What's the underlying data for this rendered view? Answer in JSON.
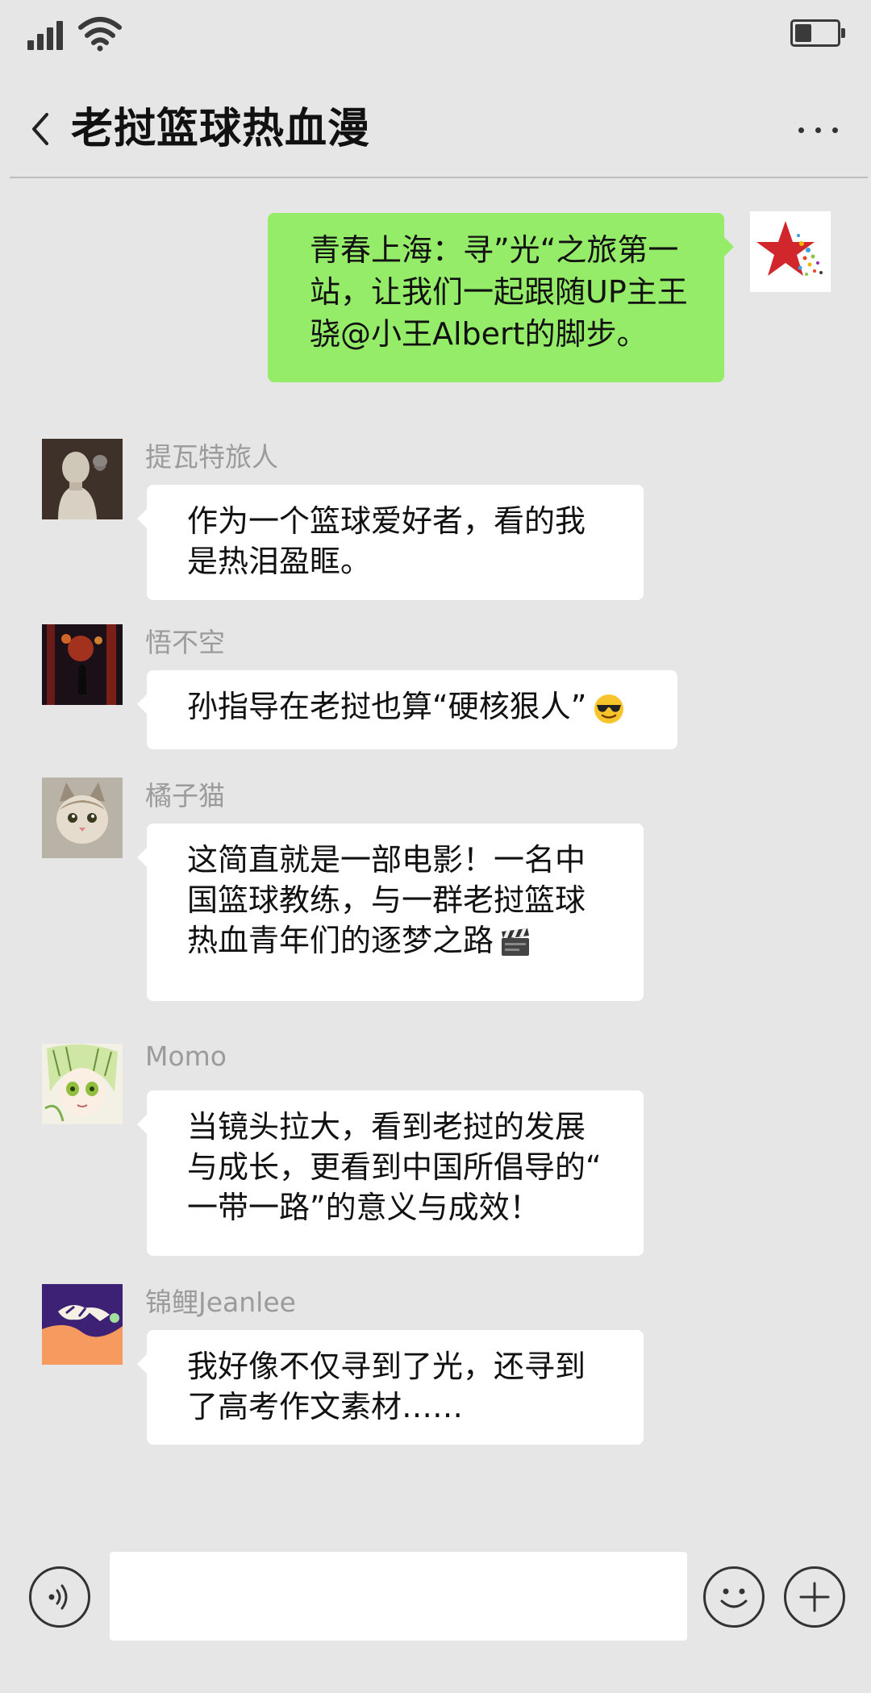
{
  "header": {
    "title": "老挝篮球热血漫"
  },
  "status_bar": {
    "signal_bars": 4,
    "battery_level": 0.4
  },
  "messages": [
    {
      "self": true,
      "lines": [
        "青春上海：寻”光“之旅第一",
        "站，让我们一起跟随UP主王",
        "骁@小王Albert的脚步。"
      ]
    },
    {
      "sender": "提瓦特旅人",
      "lines": [
        "作为一个篮球爱好者，看的我",
        "是热泪盈眶。"
      ]
    },
    {
      "sender": "悟不空",
      "lines": [
        "孙指导在老挝也算“硬核狠人”"
      ],
      "emoji": "sunglasses-emoji"
    },
    {
      "sender": "橘子猫",
      "lines": [
        "这简直就是一部电影！一名中",
        "国篮球教练，与一群老挝篮球",
        "热血青年们的逐梦之路"
      ],
      "emoji": "clapperboard-emoji"
    },
    {
      "sender": "Momo",
      "lines": [
        "当镜头拉大，看到老挝的发展",
        "与成长，更看到中国所倡导的“",
        "一带一路”的意义与成效！"
      ]
    },
    {
      "sender": "锦鲤Jeanlee",
      "lines": [
        "我好像不仅寻到了光，还寻到",
        "了高考作文素材……"
      ]
    }
  ],
  "input_bar": {
    "placeholder": "",
    "icons": [
      "voice-icon",
      "emoji-icon",
      "plus-icon"
    ]
  },
  "colors": {
    "background": "#e6e6e6",
    "self_bubble": "#95ec69",
    "other_bubble": "#ffffff",
    "sender_name": "#9b9b9b"
  }
}
